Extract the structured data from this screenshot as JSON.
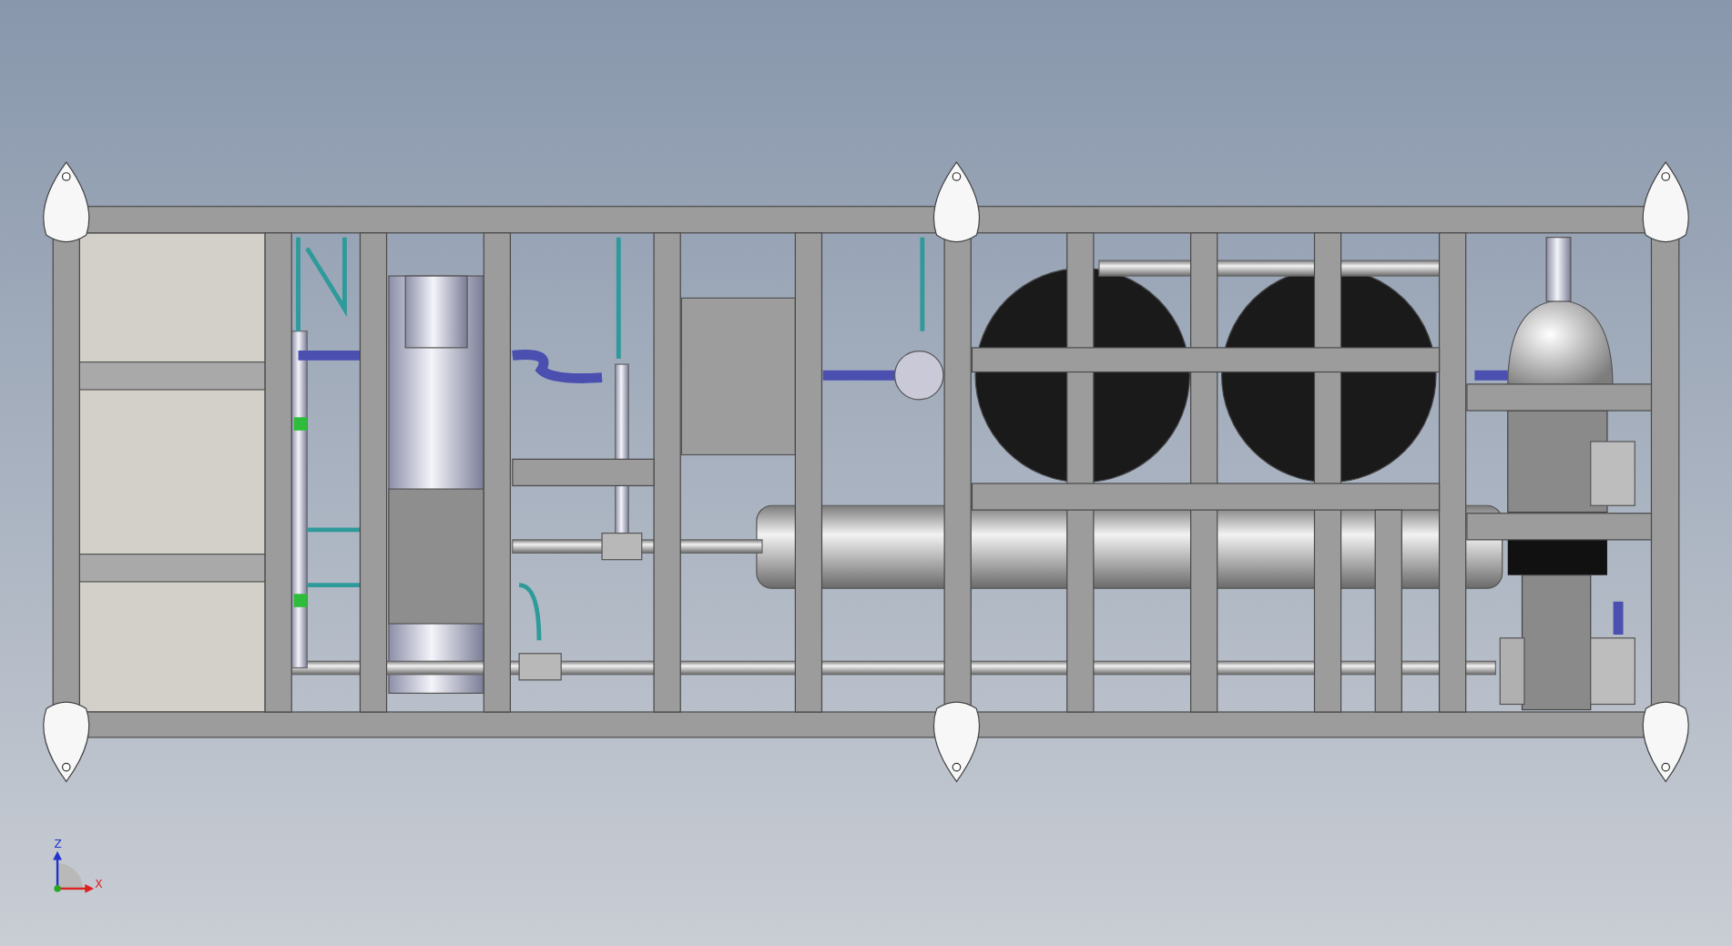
{
  "viewport": {
    "triad": {
      "z_label": "Z",
      "x_label": "X"
    }
  }
}
